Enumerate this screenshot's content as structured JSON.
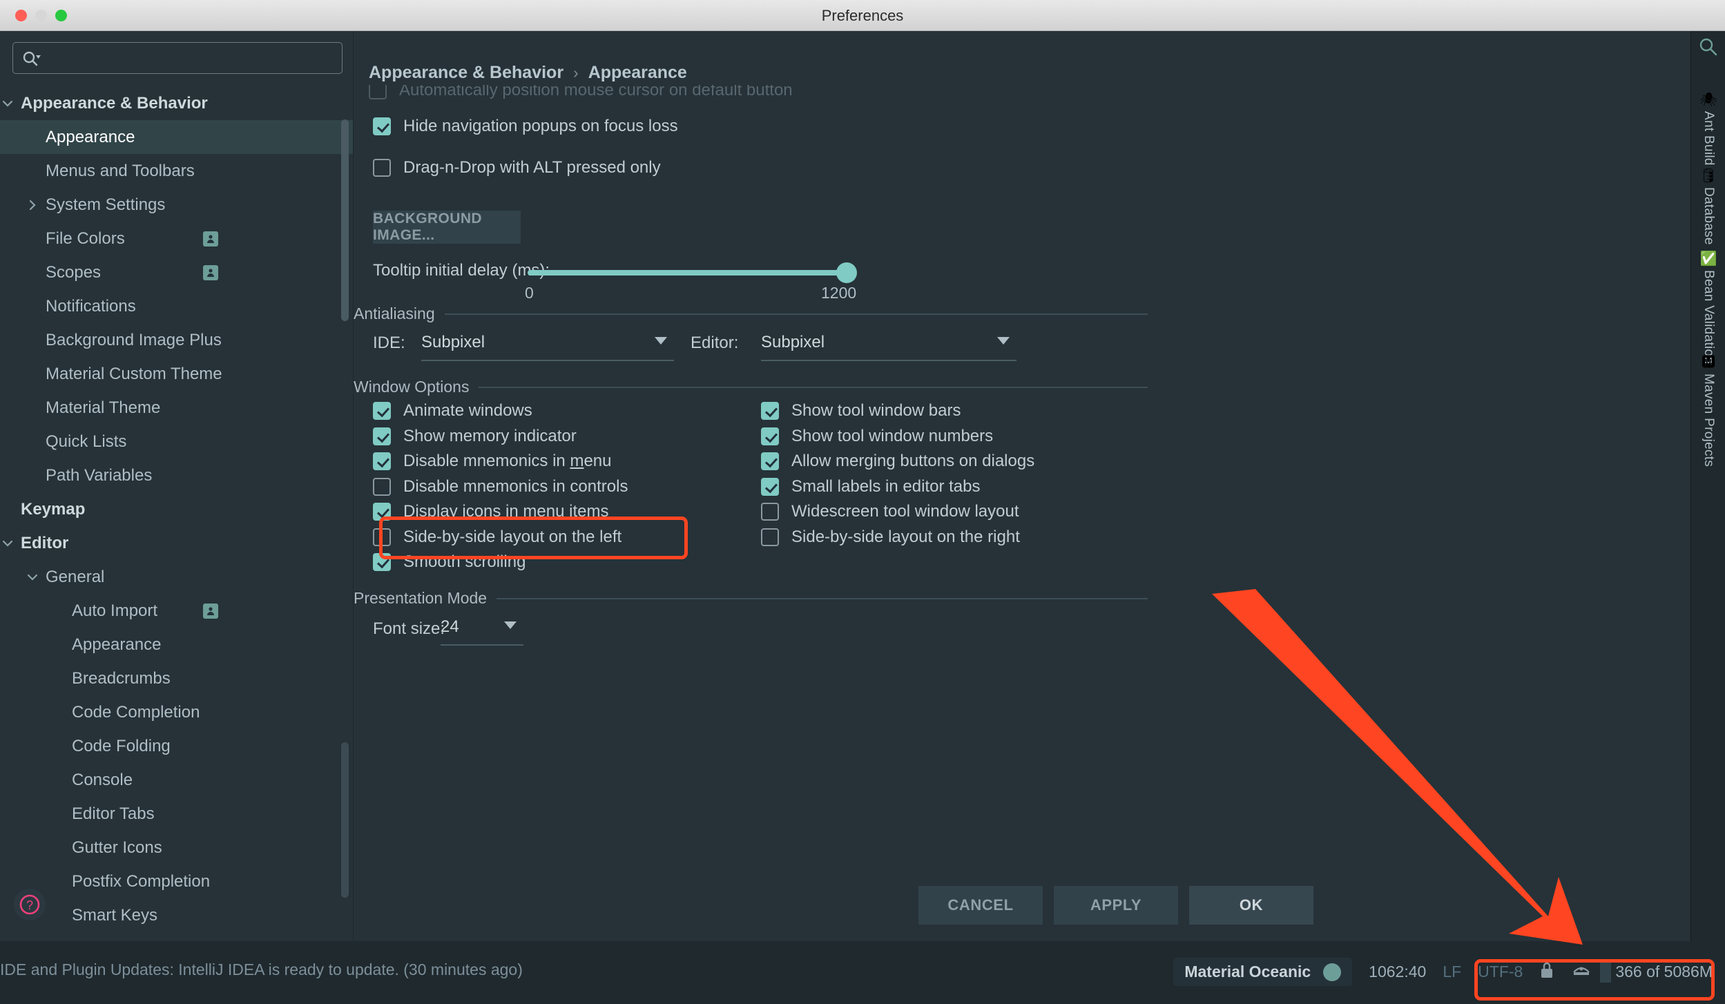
{
  "window": {
    "title": "Preferences",
    "traffic_lights": [
      "close-red",
      "minimize-gray",
      "zoom-green"
    ]
  },
  "search": {
    "placeholder": "",
    "value": "",
    "icon": "search-icon"
  },
  "sidebar": {
    "items": [
      {
        "label": "Appearance & Behavior",
        "level": 0,
        "bold": true,
        "twisty": "down",
        "selected": false,
        "badge": false
      },
      {
        "label": "Appearance",
        "level": 1,
        "bold": false,
        "twisty": "",
        "selected": true,
        "badge": false
      },
      {
        "label": "Menus and Toolbars",
        "level": 1,
        "bold": false,
        "twisty": "",
        "selected": false,
        "badge": false
      },
      {
        "label": "System Settings",
        "level": 1,
        "bold": false,
        "twisty": "right",
        "selected": false,
        "badge": false
      },
      {
        "label": "File Colors",
        "level": 1,
        "bold": false,
        "twisty": "",
        "selected": false,
        "badge": true
      },
      {
        "label": "Scopes",
        "level": 1,
        "bold": false,
        "twisty": "",
        "selected": false,
        "badge": true
      },
      {
        "label": "Notifications",
        "level": 1,
        "bold": false,
        "twisty": "",
        "selected": false,
        "badge": false
      },
      {
        "label": "Background Image Plus",
        "level": 1,
        "bold": false,
        "twisty": "",
        "selected": false,
        "badge": false
      },
      {
        "label": "Material Custom Theme",
        "level": 1,
        "bold": false,
        "twisty": "",
        "selected": false,
        "badge": false
      },
      {
        "label": "Material Theme",
        "level": 1,
        "bold": false,
        "twisty": "",
        "selected": false,
        "badge": false
      },
      {
        "label": "Quick Lists",
        "level": 1,
        "bold": false,
        "twisty": "",
        "selected": false,
        "badge": false
      },
      {
        "label": "Path Variables",
        "level": 1,
        "bold": false,
        "twisty": "",
        "selected": false,
        "badge": false
      },
      {
        "label": "Keymap",
        "level": 0,
        "bold": true,
        "twisty": "",
        "selected": false,
        "badge": false
      },
      {
        "label": "Editor",
        "level": 0,
        "bold": true,
        "twisty": "down",
        "selected": false,
        "badge": false
      },
      {
        "label": "General",
        "level": 1,
        "bold": false,
        "twisty": "down",
        "selected": false,
        "badge": false
      },
      {
        "label": "Auto Import",
        "level": 2,
        "bold": false,
        "twisty": "",
        "selected": false,
        "badge": true
      },
      {
        "label": "Appearance",
        "level": 2,
        "bold": false,
        "twisty": "",
        "selected": false,
        "badge": false
      },
      {
        "label": "Breadcrumbs",
        "level": 2,
        "bold": false,
        "twisty": "",
        "selected": false,
        "badge": false
      },
      {
        "label": "Code Completion",
        "level": 2,
        "bold": false,
        "twisty": "",
        "selected": false,
        "badge": false
      },
      {
        "label": "Code Folding",
        "level": 2,
        "bold": false,
        "twisty": "",
        "selected": false,
        "badge": false
      },
      {
        "label": "Console",
        "level": 2,
        "bold": false,
        "twisty": "",
        "selected": false,
        "badge": false
      },
      {
        "label": "Editor Tabs",
        "level": 2,
        "bold": false,
        "twisty": "",
        "selected": false,
        "badge": false
      },
      {
        "label": "Gutter Icons",
        "level": 2,
        "bold": false,
        "twisty": "",
        "selected": false,
        "badge": false
      },
      {
        "label": "Postfix Completion",
        "level": 2,
        "bold": false,
        "twisty": "",
        "selected": false,
        "badge": false
      },
      {
        "label": "Smart Keys",
        "level": 2,
        "bold": false,
        "twisty": "",
        "selected": false,
        "badge": false
      }
    ],
    "help_icon": "help-question-icon"
  },
  "breadcrumb": {
    "parent": "Appearance & Behavior",
    "separator": "›",
    "current": "Appearance"
  },
  "main": {
    "clipped_top_option": "Automatically position mouse cursor on default button",
    "top_checkboxes": [
      {
        "label": "Hide navigation popups on focus loss",
        "checked": true
      },
      {
        "label": "Drag-n-Drop with ALT pressed only",
        "checked": false
      }
    ],
    "background_image_button": "BACKGROUND IMAGE...",
    "tooltip_slider": {
      "label": "Tooltip initial delay (ms):",
      "min": "0",
      "max": "1200",
      "value": 1200
    },
    "antialiasing": {
      "section_title": "Antialiasing",
      "ide_label": "IDE:",
      "ide_value": "Subpixel",
      "editor_label": "Editor:",
      "editor_value": "Subpixel"
    },
    "window_options": {
      "section_title": "Window Options",
      "left_column": [
        {
          "label": "Animate windows",
          "checked": true
        },
        {
          "label": "Show memory indicator",
          "checked": true,
          "highlighted": true
        },
        {
          "label": "Disable mnemonics in menu",
          "checked": true,
          "mnemonic": "m"
        },
        {
          "label": "Disable mnemonics in controls",
          "checked": false
        },
        {
          "label": "Display icons in menu items",
          "checked": true
        },
        {
          "label": "Side-by-side layout on the left",
          "checked": false
        },
        {
          "label": "Smooth scrolling",
          "checked": true
        }
      ],
      "right_column": [
        {
          "label": "Show tool window bars",
          "checked": true
        },
        {
          "label": "Show tool window numbers",
          "checked": true
        },
        {
          "label": "Allow merging buttons on dialogs",
          "checked": true
        },
        {
          "label": "Small labels in editor tabs",
          "checked": true
        },
        {
          "label": "Widescreen tool window layout",
          "checked": false
        },
        {
          "label": "Side-by-side layout on the right",
          "checked": false
        }
      ]
    },
    "presentation_mode": {
      "section_title": "Presentation Mode",
      "font_size_label": "Font size:",
      "font_size_value": "24"
    }
  },
  "footer": {
    "cancel": "CANCEL",
    "apply": "APPLY",
    "ok": "OK"
  },
  "right_toolbar": {
    "search_icon": "search-icon",
    "items": [
      {
        "label": "Ant Build",
        "icon": "ant-icon"
      },
      {
        "label": "Database",
        "icon": "database-icon"
      },
      {
        "label": "Bean Validation",
        "icon": "bean-check-icon"
      },
      {
        "label": "Maven Projects",
        "icon": "maven-icon"
      }
    ]
  },
  "statusbar": {
    "message": "IDE and Plugin Updates: IntelliJ IDEA is ready to update. (30 minutes ago)",
    "theme": "Material Oceanic",
    "caret": "1062:40",
    "line_separator": "LF",
    "encoding": "UTF-8",
    "lock_icon": "lock-icon",
    "inspection_icon": "inspection-hat-icon",
    "memory": "366 of 5086M"
  },
  "annotations": {
    "highlight_color": "#ff4521",
    "arrow_color": "#ff4521"
  }
}
